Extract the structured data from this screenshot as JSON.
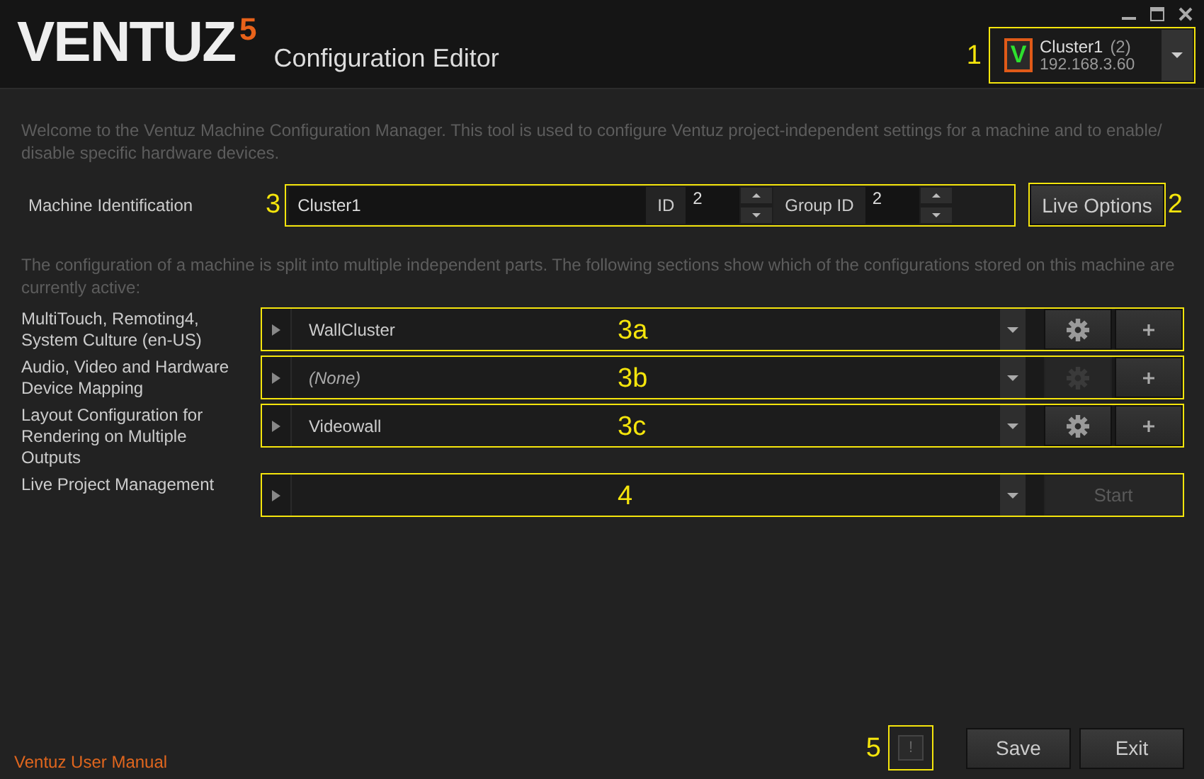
{
  "header": {
    "logo": {
      "wordmark": "VENTUZ",
      "version": "5"
    },
    "title": "Configuration Editor"
  },
  "cluster": {
    "badge": "V",
    "name": "Cluster1",
    "count": "(2)",
    "address": "192.168.3.60",
    "callout": "1"
  },
  "intro": "Welcome to the Ventuz Machine Configuration Manager. This tool is used to configure Ventuz project-independent settings for a machine and to enable/ disable specific hardware devices.",
  "machine_identification": {
    "label": "Machine Identification",
    "name": "Cluster1",
    "id_label": "ID",
    "id": "2",
    "group_id_label": "Group ID",
    "group_id": "2",
    "callout": "3"
  },
  "live_options": {
    "label": "Live Options",
    "callout": "2"
  },
  "sections_intro": "The configuration of a machine is split into multiple independent parts. The following sections show which of the configurations stored on this machine are currently active:",
  "sections": [
    {
      "kind": "config",
      "label": "MultiTouch, Remoting4, System Culture (en-US)",
      "value": "WallCluster",
      "empty": false,
      "settings_disabled": false,
      "callout": "3a"
    },
    {
      "kind": "config",
      "label": "Audio, Video and Hardware Device Mapping",
      "value": "(None)",
      "empty": true,
      "settings_disabled": true,
      "callout": "3b"
    },
    {
      "kind": "config",
      "label": "Layout Configuration for Rendering on Multiple Outputs",
      "value": "Videowall",
      "empty": false,
      "settings_disabled": false,
      "callout": "3c"
    },
    {
      "kind": "project",
      "label": "Live Project Management",
      "button": "Start",
      "disabled": true,
      "callout": "4"
    }
  ],
  "footer": {
    "manual_link": "Ventuz User Manual",
    "notice": "!",
    "notice_callout": "5",
    "buttons": [
      "Save",
      "Exit"
    ]
  }
}
